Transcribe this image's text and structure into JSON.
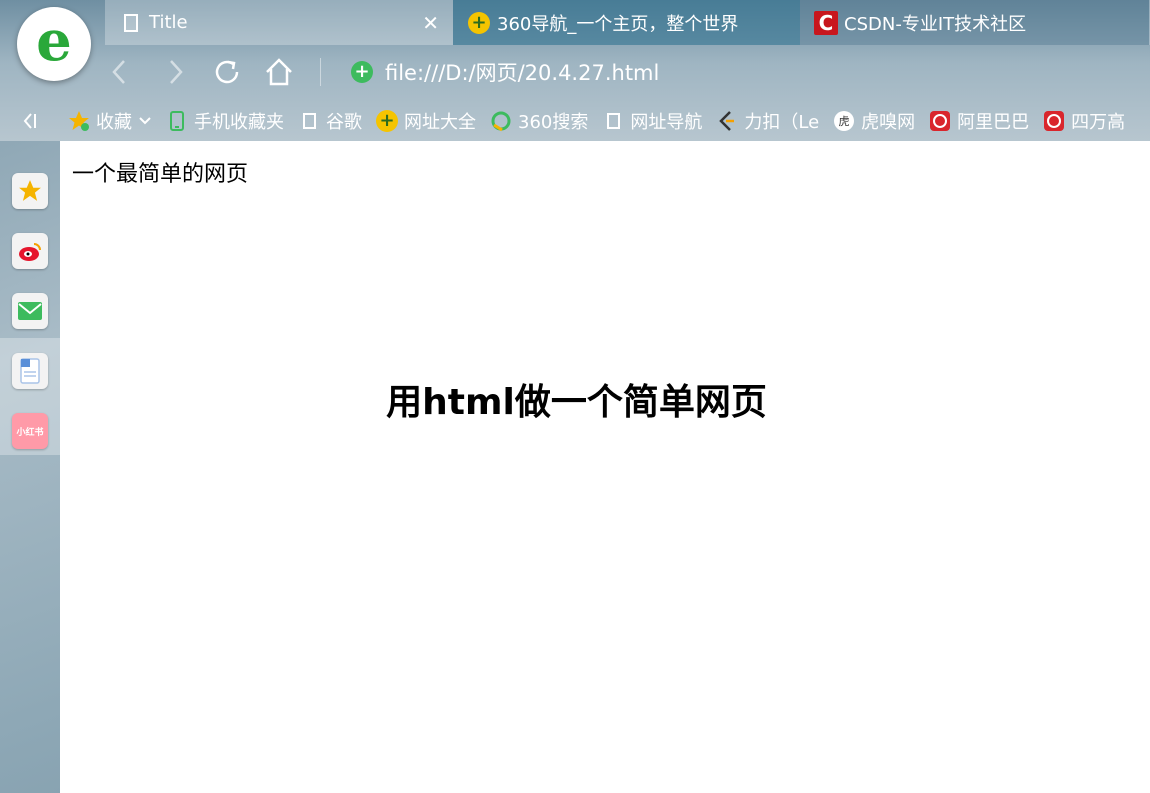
{
  "browser": {
    "logo_letter": "e",
    "tabs": [
      {
        "label": "Title",
        "icon": "document-icon",
        "close": "✕"
      },
      {
        "label": "360导航_一个主页，整个世界",
        "icon": "360-icon"
      },
      {
        "label": "CSDN-专业IT技术社区",
        "icon": "csdn-icon"
      }
    ],
    "address": {
      "url": "file:///D:/网页/20.4.27.html"
    },
    "bookmarks": [
      {
        "label": "收藏",
        "icon": "star-icon"
      },
      {
        "label": "手机收藏夹",
        "icon": "phone-icon"
      },
      {
        "label": "谷歌",
        "icon": "document-icon"
      },
      {
        "label": "网址大全",
        "icon": "360-icon"
      },
      {
        "label": "360搜索",
        "icon": "search-360-icon"
      },
      {
        "label": "网址导航",
        "icon": "document-icon"
      },
      {
        "label": "力扣（Le",
        "icon": "leetcode-icon"
      },
      {
        "label": "虎嗅网",
        "icon": "huxiu-icon"
      },
      {
        "label": "阿里巴巴",
        "icon": "alibaba-icon"
      },
      {
        "label": "四万高",
        "icon": "alibaba-icon"
      }
    ],
    "sidebar": [
      "favorites-star-icon",
      "weibo-icon",
      "mail-icon",
      "word-doc-icon",
      "xiaohongshu-icon"
    ],
    "sidebar_xiaohongshu_text": "小红书"
  },
  "page": {
    "text": "一个最简单的网页",
    "heading": "用html做一个简单网页"
  }
}
